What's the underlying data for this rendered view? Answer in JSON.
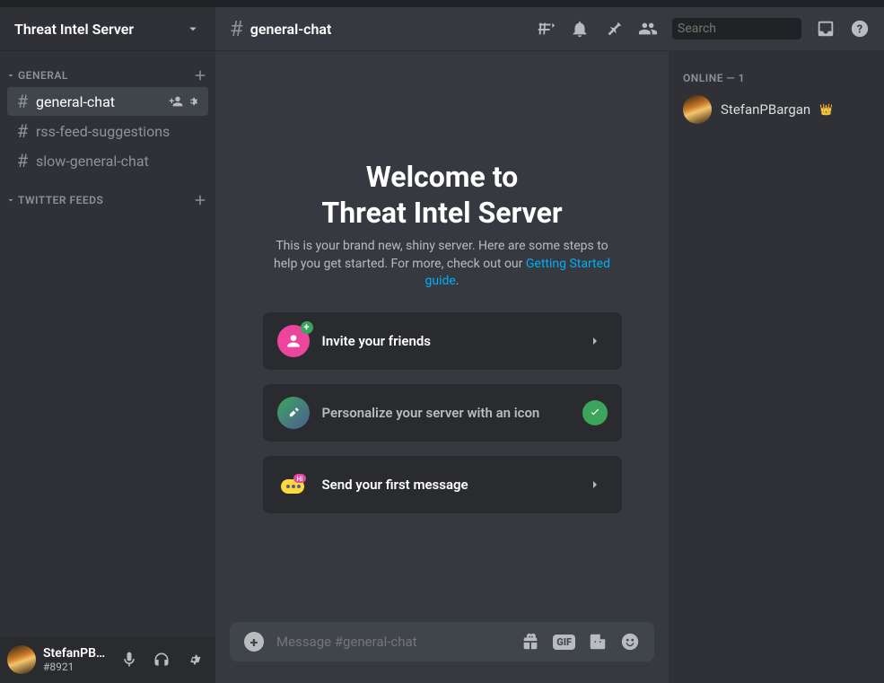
{
  "server": {
    "name": "Threat Intel Server"
  },
  "sidebar": {
    "categories": [
      {
        "name": "GENERAL"
      },
      {
        "name": "TWITTER FEEDS"
      }
    ],
    "channels": [
      {
        "label": "general-chat"
      },
      {
        "label": "rss-feed-suggestions"
      },
      {
        "label": "slow-general-chat"
      }
    ]
  },
  "header": {
    "channel": "general-chat",
    "search_placeholder": "Search"
  },
  "welcome": {
    "line1": "Welcome to",
    "line2": "Threat Intel Server",
    "desc_prefix": "This is your brand new, shiny server. Here are some steps to help you get started. For more, check out our ",
    "link": "Getting Started guide",
    "desc_suffix": "."
  },
  "cards": {
    "invite": "Invite your friends",
    "personalize": "Personalize your server with an icon",
    "first_msg": "Send your first message"
  },
  "composer": {
    "placeholder": "Message #general-chat",
    "gif_label": "GIF"
  },
  "members": {
    "header": "ONLINE — 1",
    "user1": "StefanPBargan"
  },
  "user_panel": {
    "name": "StefanPBa...",
    "tag": "#8921"
  }
}
